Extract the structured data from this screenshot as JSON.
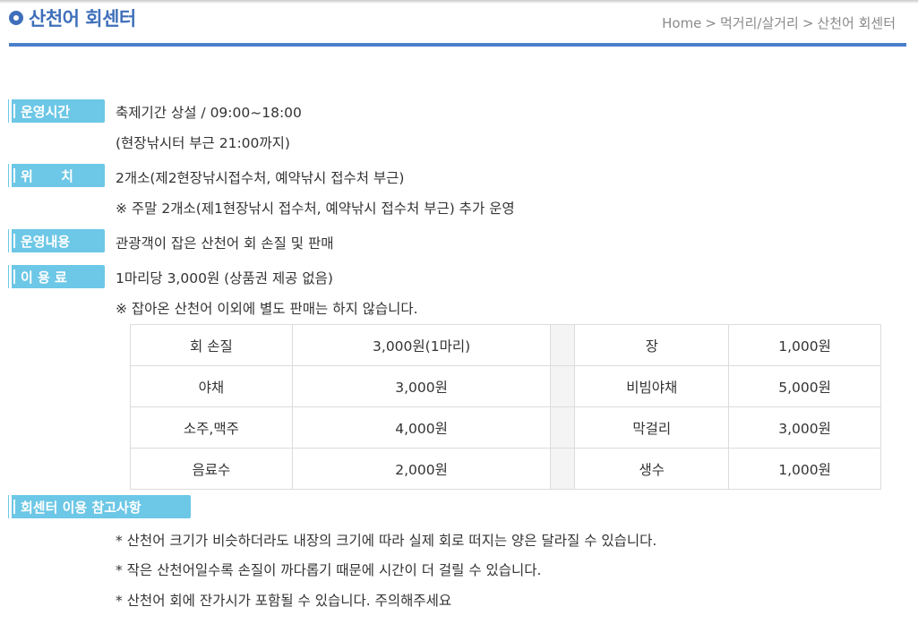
{
  "header": {
    "title": "산천어 회센터",
    "breadcrumb": [
      "Home",
      "먹거리/살거리",
      "산천어 회센터"
    ],
    "breadcrumb_separator": ">"
  },
  "sections": {
    "hours": {
      "label": "운영시간",
      "lines": [
        "축제기간 상설 / 09:00~18:00",
        "(현장낚시터 부근 21:00까지)"
      ]
    },
    "location": {
      "label": "위      치",
      "lines": [
        "2개소(제2현장낚시접수처, 예약낚시 접수처 부근)",
        "※ 주말 2개소(제1현장낚시 접수처, 예약낚시 접수처 부근) 추가 운영"
      ]
    },
    "service": {
      "label": "운영내용",
      "lines": [
        "관광객이 잡은 산천어 회 손질 및 판매"
      ]
    },
    "fee": {
      "label": "이 용 료",
      "lines": [
        "1마리당 3,000원 (상품권 제공 없음)",
        "※ 잡아온 산천어 이외에 별도 판매는 하지 않습니다."
      ]
    },
    "notes": {
      "label": "회센터 이용 참고사항",
      "lines": [
        "* 산천어 크기가 비슷하더라도 내장의 크기에 따라 실제 회로 떠지는 양은 달라질 수 있습니다.",
        "* 작은 산천어일수록 손질이 까다롭기 때문에 시간이 더 걸릴 수 있습니다.",
        "* 산천어 회에 잔가시가 포함될 수 있습니다. 주의해주세요"
      ]
    }
  },
  "price_table": {
    "rows": [
      {
        "left_item": "회 손질",
        "left_price": "3,000원(1마리)",
        "right_item": "장",
        "right_price": "1,000원"
      },
      {
        "left_item": "야채",
        "left_price": "3,000원",
        "right_item": "비빔야채",
        "right_price": "5,000원"
      },
      {
        "left_item": "소주,맥주",
        "left_price": "4,000원",
        "right_item": "막걸리",
        "right_price": "3,000원"
      },
      {
        "left_item": "음료수",
        "left_price": "2,000원",
        "right_item": "생수",
        "right_price": "1,000원"
      }
    ]
  },
  "colors": {
    "title": "#3f6fba",
    "header_rule": "#4a7fcb",
    "label_bg": "#6dc7e6",
    "breadcrumb": "#8a8a8a"
  }
}
